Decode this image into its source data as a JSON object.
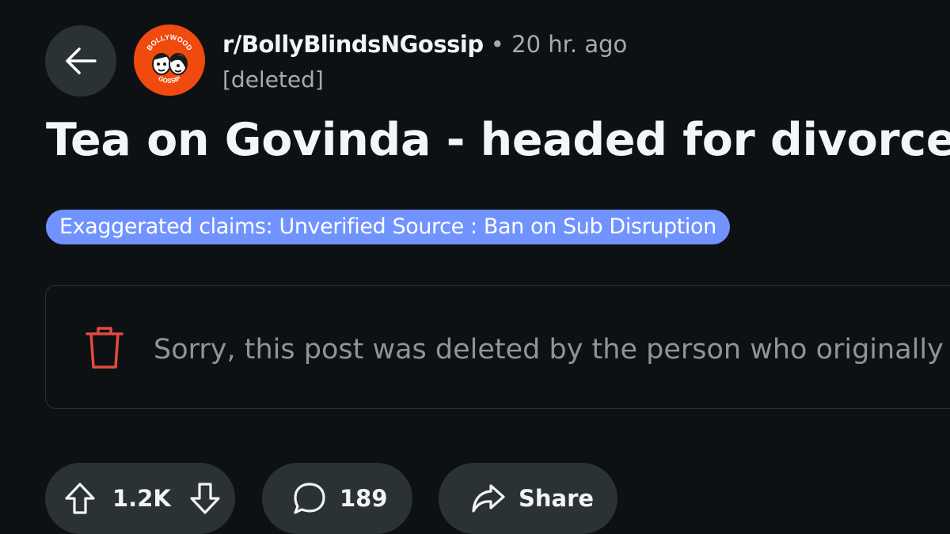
{
  "header": {
    "back_icon": "arrow-left-icon",
    "subreddit": "r/BollyBlindsNGossip",
    "separator": "•",
    "time_ago": "20 hr. ago",
    "author": "[deleted]",
    "avatar": {
      "icon": "bollywood-gossip-logo",
      "top_text": "BOLLYWOOD",
      "bottom_text": "GOSSIP",
      "color": "#f04a0e"
    }
  },
  "post": {
    "title": "Tea on Govinda - headed for divorce",
    "flair": "Exaggerated claims: Unverified Source : Ban on Sub Disruption",
    "flair_color": "#7193ff",
    "deleted_icon": "trash-icon",
    "deleted_message": "Sorry, this post was deleted by the person who originally p"
  },
  "actions": {
    "upvote_icon": "upvote-arrow-icon",
    "vote_count": "1.2K",
    "downvote_icon": "downvote-arrow-icon",
    "comment_icon": "comment-bubble-icon",
    "comment_count": "189",
    "share_icon": "share-arrow-icon",
    "share_label": "Share"
  },
  "colors": {
    "background": "#0e1113",
    "pill_background": "#2a3236",
    "trash_red": "#e34b3f",
    "muted_text": "#a4acb3"
  }
}
